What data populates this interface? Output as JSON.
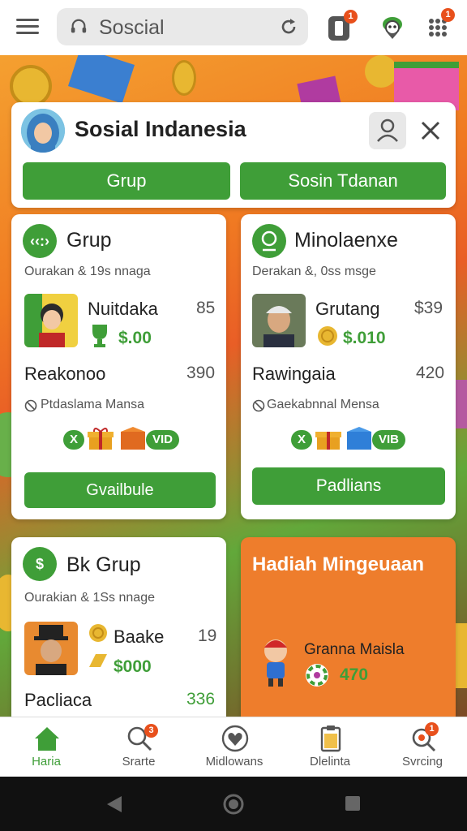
{
  "search": {
    "text": "Soscial"
  },
  "top_icons": {
    "phone_badge": "1",
    "apps_badge": "1"
  },
  "header_card": {
    "title": "Sosial Indanesia",
    "btn_left": "Grup",
    "btn_right": "Sosin Tdanan"
  },
  "card1": {
    "icon_text": "‹‹:›",
    "title": "Grup",
    "subtitle": "Ourakan & 19s nnaga",
    "name": "Nuitdaka",
    "score": "85",
    "money": "$.00",
    "row_label": "Reakonoo",
    "row_num": "390",
    "status": "Ptdaslama Mansa",
    "pill_left": "X",
    "pill_right": "VID",
    "button": "Gvailbule"
  },
  "card2": {
    "title": "Minolaenxe",
    "subtitle": "Derakan &, 0ss msge",
    "name": "Grutang",
    "score": "$39",
    "money": "$.010",
    "row_label": "Rawingaia",
    "row_num": "420",
    "status": "Gaekabnnal Mensa",
    "pill_left": "X",
    "pill_right": "VIB",
    "button": "Padlians"
  },
  "card3": {
    "icon_text": "$",
    "title": "Bk Grup",
    "subtitle": "Ourakian & 1Ss nnage",
    "name": "Baake",
    "score": "19",
    "money": "$000",
    "row_label": "Pacliaca",
    "row_num": "336"
  },
  "promo": {
    "title": "Hadiah Mingeuaan",
    "name": "Granna Maisla",
    "amount": "470"
  },
  "nav": {
    "items": [
      {
        "label": "Haria"
      },
      {
        "label": "Srarte",
        "badge": "3"
      },
      {
        "label": "Midlowans"
      },
      {
        "label": "Dlelinta"
      },
      {
        "label": "Svrcing",
        "badge": "1"
      }
    ]
  },
  "colors": {
    "accent": "#3f9e38",
    "promo": "#ee7d2c",
    "badge": "#e8501c"
  }
}
